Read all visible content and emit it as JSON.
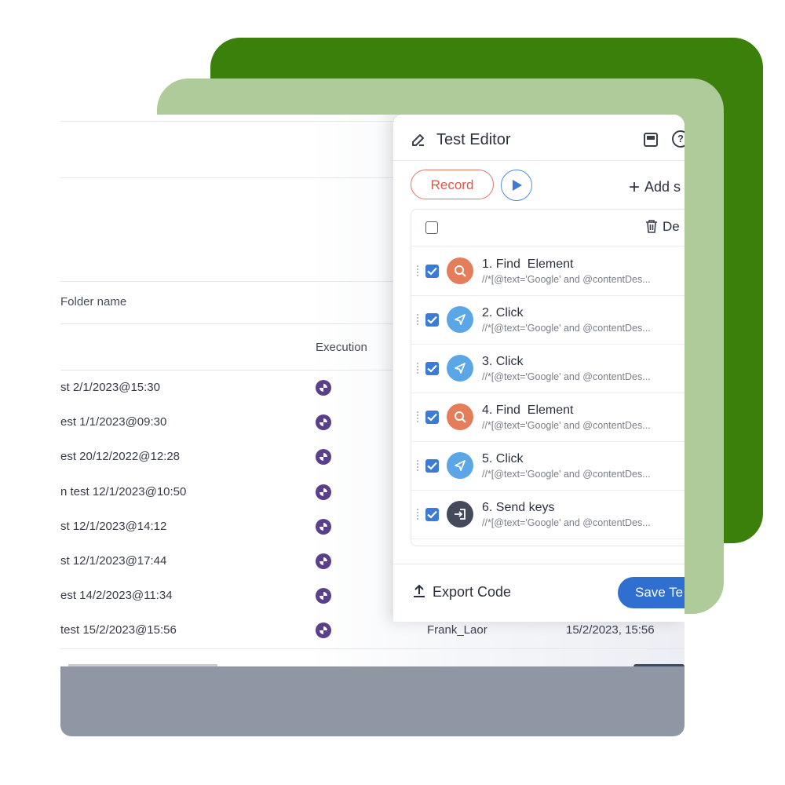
{
  "background_table": {
    "folder_label": "Folder name",
    "execution_header": "Execution",
    "rows": [
      {
        "name": "st 2/1/2023@15:30"
      },
      {
        "name": "est 1/1/2023@09:30"
      },
      {
        "name": "est 20/12/2022@12:28"
      },
      {
        "name": "n test 12/1/2023@10:50"
      },
      {
        "name": "st 12/1/2023@14:12"
      },
      {
        "name": "st 12/1/2023@17:44"
      },
      {
        "name": "est 14/2/2023@11:34"
      },
      {
        "name": " test 15/2/2023@15:56",
        "owner": "Frank_Laor",
        "date": "15/2/2023, 15:56"
      }
    ]
  },
  "editor": {
    "title": "Test Editor",
    "record_label": "Record",
    "add_step_label": "Add s",
    "delete_label": "De",
    "export_label": "Export Code",
    "save_label": "Save Te",
    "steps": [
      {
        "title": "1. Find  Element",
        "xpath": "//*[@text='Google' and @contentDes...",
        "icon": "search-icon",
        "color": "#e57c5a"
      },
      {
        "title": "2. Click",
        "xpath": "//*[@text='Google' and @contentDes...",
        "icon": "pointer-icon",
        "color": "#5aa6e6"
      },
      {
        "title": "3. Click",
        "xpath": "//*[@text='Google' and @contentDes...",
        "icon": "pointer-icon",
        "color": "#5aa6e6"
      },
      {
        "title": "4. Find  Element",
        "xpath": "//*[@text='Google' and @contentDes...",
        "icon": "search-icon",
        "color": "#e57c5a"
      },
      {
        "title": "5. Click",
        "xpath": "//*[@text='Google' and @contentDes...",
        "icon": "pointer-icon",
        "color": "#5aa6e6"
      },
      {
        "title": "6. Send keys",
        "xpath": "//*[@text='Google' and @contentDes...",
        "icon": "keyboard-enter-icon",
        "color": "#424a5c"
      }
    ]
  },
  "colors": {
    "brand_dark_green": "#3c800c",
    "brand_light_green": "#aecb99",
    "primary_blue": "#2f6fcf",
    "record_red": "#d9584b",
    "execution_purple": "#5a3f8c"
  }
}
